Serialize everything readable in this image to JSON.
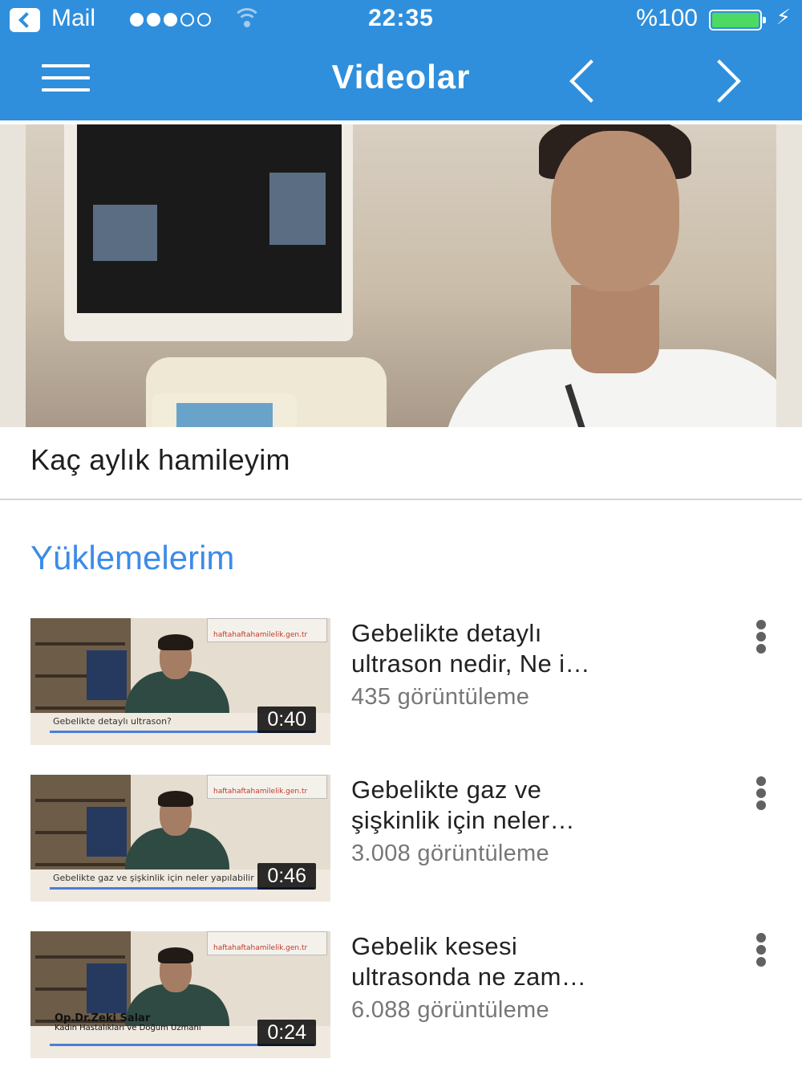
{
  "status_bar": {
    "carrier": "Mail",
    "time": "22:35",
    "battery_percent": "%100",
    "signal_bars": 3,
    "signal_max": 5,
    "battery_color": "#4cd964"
  },
  "nav": {
    "title": "Videolar",
    "menu_icon": "hamburger-menu-icon",
    "prev_icon": "chevron-left-icon",
    "next_icon": "chevron-right-icon",
    "background": "#2f8fdc"
  },
  "featured": {
    "title": "Kaç aylık hamileyim"
  },
  "section": {
    "title": "Yüklemelerim",
    "color": "#3d8be8"
  },
  "videos": [
    {
      "title_line1": "Gebelikte detaylı",
      "title_line2": "ultrason nedir, Ne i…",
      "views": "435 görüntüleme",
      "duration": "0:40",
      "thumb_caption": "Gebelikte detaylı ultrason?",
      "thumb_watermark": "haftahaftahamilelik.gen.tr"
    },
    {
      "title_line1": "Gebelikte gaz ve",
      "title_line2": "şişkinlik için neler…",
      "views": "3.008 görüntüleme",
      "duration": "0:46",
      "thumb_caption": "Gebelikte gaz ve şişkinlik için neler yapılabilir",
      "thumb_watermark": "haftahaftahamilelik.gen.tr"
    },
    {
      "title_line1": "Gebelik kesesi",
      "title_line2": "ultrasonda ne zam…",
      "views": "6.088 görüntüleme",
      "duration": "0:24",
      "thumb_caption_name": "Op.Dr.Zeki Salar",
      "thumb_caption_sub": "Kadın Hastalıkları ve Doğum Uzmanı",
      "thumb_watermark": "haftahaftahamilelik.gen.tr"
    }
  ]
}
